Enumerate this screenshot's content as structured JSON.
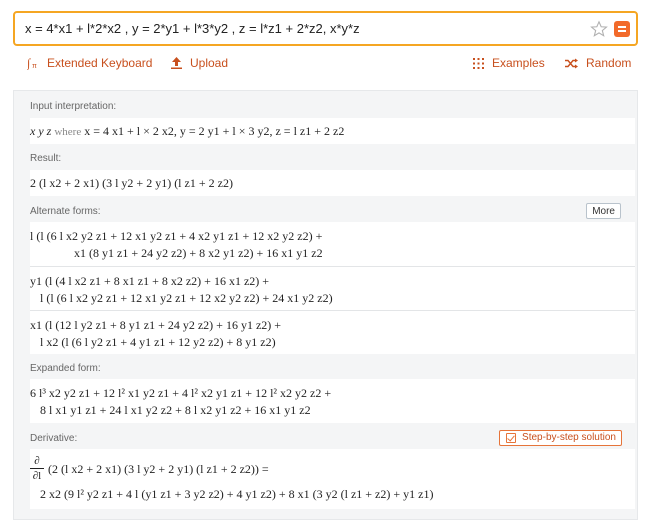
{
  "search": {
    "query": "x = 4*x1 + l*2*x2 , y = 2*y1 + l*3*y2 , z = l*z1 + 2*z2, x*y*z"
  },
  "toolbar": {
    "extended_keyboard": "Extended Keyboard",
    "upload": "Upload",
    "examples": "Examples",
    "random": "Random"
  },
  "pods": {
    "input_label": "Input interpretation:",
    "input_expr": "x y z",
    "input_where": "where",
    "input_rest": "x = 4 x1 + l × 2 x2, y = 2 y1 + l × 3 y2, z = l z1 + 2 z2",
    "result_label": "Result:",
    "result_expr": "2 (l x2 + 2 x1) (3 l y2 + 2 y1) (l z1 + 2 z2)",
    "alt_label": "Alternate forms:",
    "more_button": "More",
    "alt1_line1": "l (l (6 l x2 y2 z1 + 12 x1 y2 z1 + 4 x2 y1 z1 + 12 x2 y2 z2) +",
    "alt1_line2": "x1 (8 y1 z1 + 24 y2 z2) + 8 x2 y1 z2) + 16 x1 y1 z2",
    "alt2_line1": "y1 (l (4 l x2 z1 + 8 x1 z1 + 8 x2 z2) + 16 x1 z2) +",
    "alt2_line2": "l (l (6 l x2 y2 z1 + 12 x1 y2 z1 + 12 x2 y2 z2) + 24 x1 y2 z2)",
    "alt3_line1": "x1 (l (12 l y2 z1 + 8 y1 z1 + 24 y2 z2) + 16 y1 z2) +",
    "alt3_line2": "l x2 (l (6 l y2 z1 + 4 y1 z1 + 12 y2 z2) + 8 y1 z2)",
    "expanded_label": "Expanded form:",
    "exp_line1": "6 l³ x2 y2 z1 + 12 l² x1 y2 z1 + 4 l² x2 y1 z1 + 12 l² x2 y2 z2 +",
    "exp_line2": "8 l x1 y1 z1 + 24 l x1 y2 z2 + 8 l x2 y1 z2 + 16 x1 y1 z2",
    "derivative_label": "Derivative:",
    "step_button": "Step-by-step solution",
    "deriv_num": "∂",
    "deriv_den": "∂l",
    "deriv_line1": "(2 (l x2 + 2 x1) (3 l y2 + 2 y1) (l z1 + 2 z2)) =",
    "deriv_line2": "2 x2 (9 l² y2 z1 + 4 l (y1 z1 + 3 y2 z2) + 4 y1 z2) + 8 x1 (3 y2 (l z1 + z2) + y1 z1)"
  },
  "colors": {
    "accent": "#f5a623",
    "link": "#c8501e",
    "panel_bg": "#f4f5f6"
  }
}
